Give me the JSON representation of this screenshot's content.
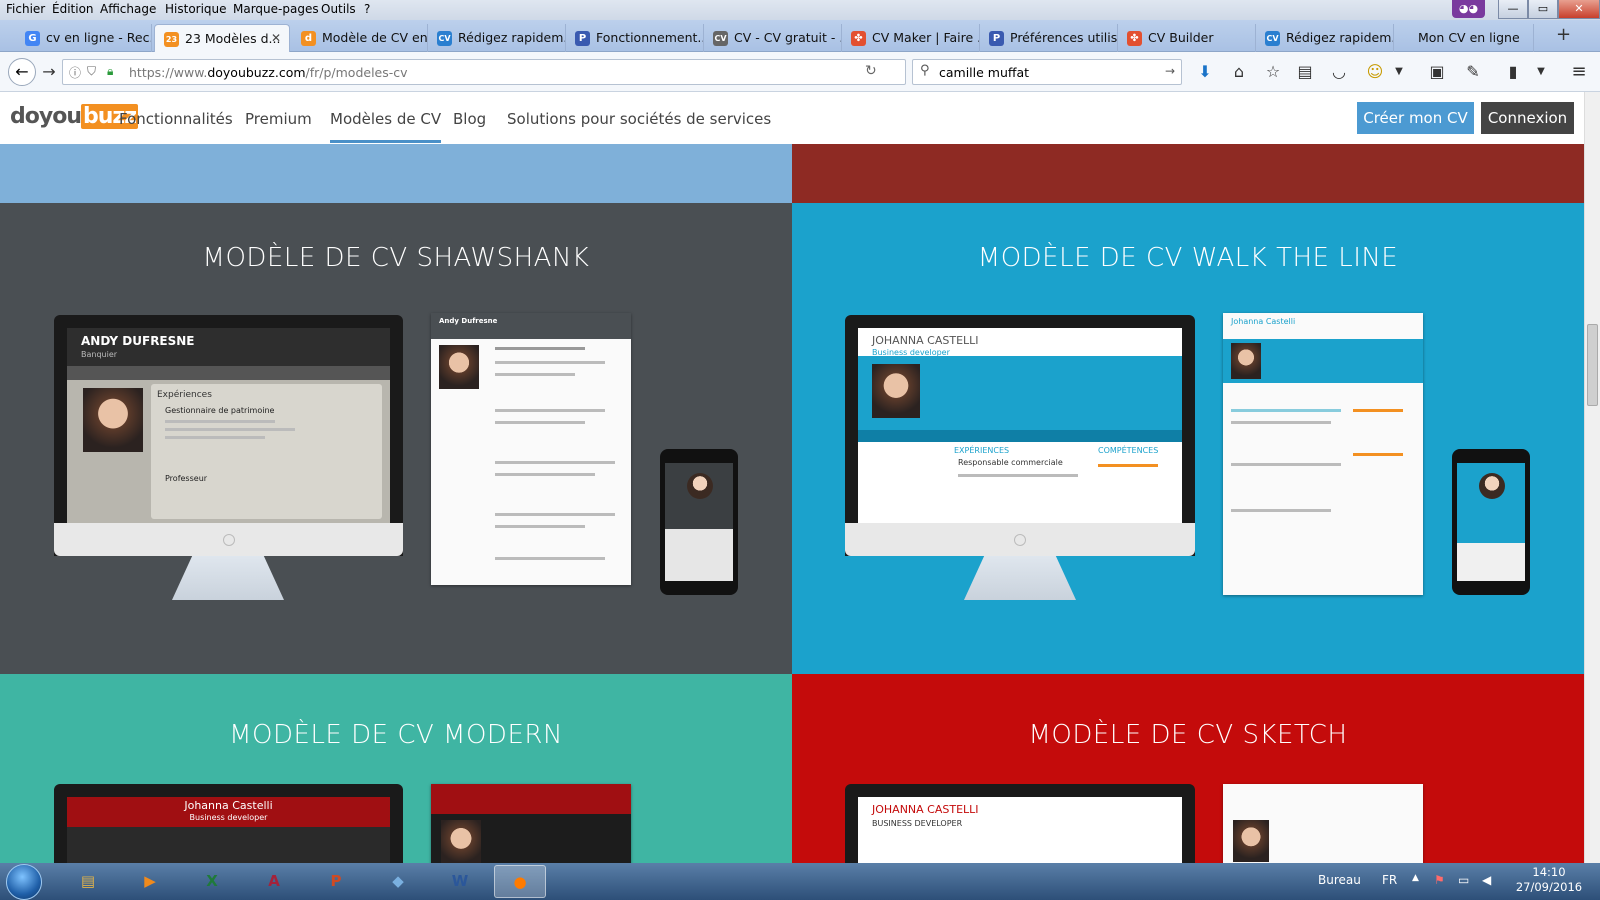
{
  "menubar": {
    "items": [
      "Fichier",
      "Édition",
      "Affichage",
      "Historique",
      "Marque-pages",
      "Outils",
      "?"
    ],
    "minimize": "—",
    "maximize": "▭",
    "close": "✕"
  },
  "tabs": [
    {
      "label": "cv en ligne - Rec...",
      "fav": "G",
      "fav_color": "#4285f4"
    },
    {
      "label": "23 Modèles d...",
      "fav": "23",
      "fav_color": "#f39021",
      "close": "✕"
    },
    {
      "label": "Modèle de CV en...",
      "fav": "d",
      "fav_color": "#f39021"
    },
    {
      "label": "Rédigez rapidem...",
      "fav": "CV",
      "fav_color": "#2a7fd0"
    },
    {
      "label": "Fonctionnement...",
      "fav": "P",
      "fav_color": "#3a5ab0"
    },
    {
      "label": "CV - CV gratuit - ...",
      "fav": "CV",
      "fav_color": "#666"
    },
    {
      "label": "CV Maker | Faire ...",
      "fav": "✤",
      "fav_color": "#e35030"
    },
    {
      "label": "Préférences utilis...",
      "fav": "P",
      "fav_color": "#3a5ab0"
    },
    {
      "label": "CV Builder",
      "fav": "✤",
      "fav_color": "#e35030"
    },
    {
      "label": "Rédigez rapidem...",
      "fav": "CV",
      "fav_color": "#2a7fd0"
    },
    {
      "label": "Mon CV en ligne",
      "fav": "",
      "fav_color": "transparent"
    }
  ],
  "newtab": "+",
  "navbar": {
    "url_prefix": "https://www.",
    "url_domain": "doyoubuzz.com",
    "url_path": "/fr/p/modeles-cv",
    "search_query": "camille muffat"
  },
  "site": {
    "logo_a": "doyou",
    "logo_b": "buzz",
    "nav": [
      "Fonctionnalités",
      "Premium",
      "Modèles de CV",
      "Blog",
      "Solutions pour sociétés de services"
    ],
    "create_btn": "Créer mon CV",
    "login_btn": "Connexion"
  },
  "panels": [
    {
      "title": "MODÈLE DE CV SHAWSHANK",
      "bg": "#4a4f53",
      "name": "ANDY DUFRESNE",
      "role": "Banquier",
      "paper_name": "Andy Dufresne",
      "section": "Expériences",
      "job": "Gestionnaire de patrimoine",
      "job2": "Professeur"
    },
    {
      "title": "MODÈLE DE CV WALK THE LINE",
      "bg": "#1ba2cc",
      "name": "JOHANNA CASTELLI",
      "role": "Business developer",
      "paper_name": "Johanna Castelli",
      "section": "EXPÉRIENCES",
      "job": "Responsable commerciale",
      "job2": "COMPÉTENCES"
    },
    {
      "title": "MODÈLE DE CV MODERN",
      "bg": "#3fb5a3",
      "name": "Johanna Castelli",
      "role": "Business developer"
    },
    {
      "title": "MODÈLE DE CV SKETCH",
      "bg": "#c40b0b",
      "name": "JOHANNA CASTELLI",
      "role": "BUSINESS DEVELOPER"
    }
  ],
  "top_strip": {
    "left": "#7fb0d9",
    "right": "#8e2a23"
  },
  "taskbar": {
    "apps": [
      {
        "label": "▤",
        "color": "#e0b24a"
      },
      {
        "label": "▶",
        "color": "#f08a1c"
      },
      {
        "label": "X",
        "color": "#1f7a3a"
      },
      {
        "label": "A",
        "color": "#a4223a"
      },
      {
        "label": "P",
        "color": "#d04a22"
      },
      {
        "label": "◆",
        "color": "#7ab0e0"
      },
      {
        "label": "W",
        "color": "#2b579a"
      },
      {
        "label": "●",
        "color": "#ff7b00"
      }
    ],
    "desktop": "Bureau",
    "lang": "FR",
    "time": "14:10",
    "date": "27/09/2016"
  }
}
